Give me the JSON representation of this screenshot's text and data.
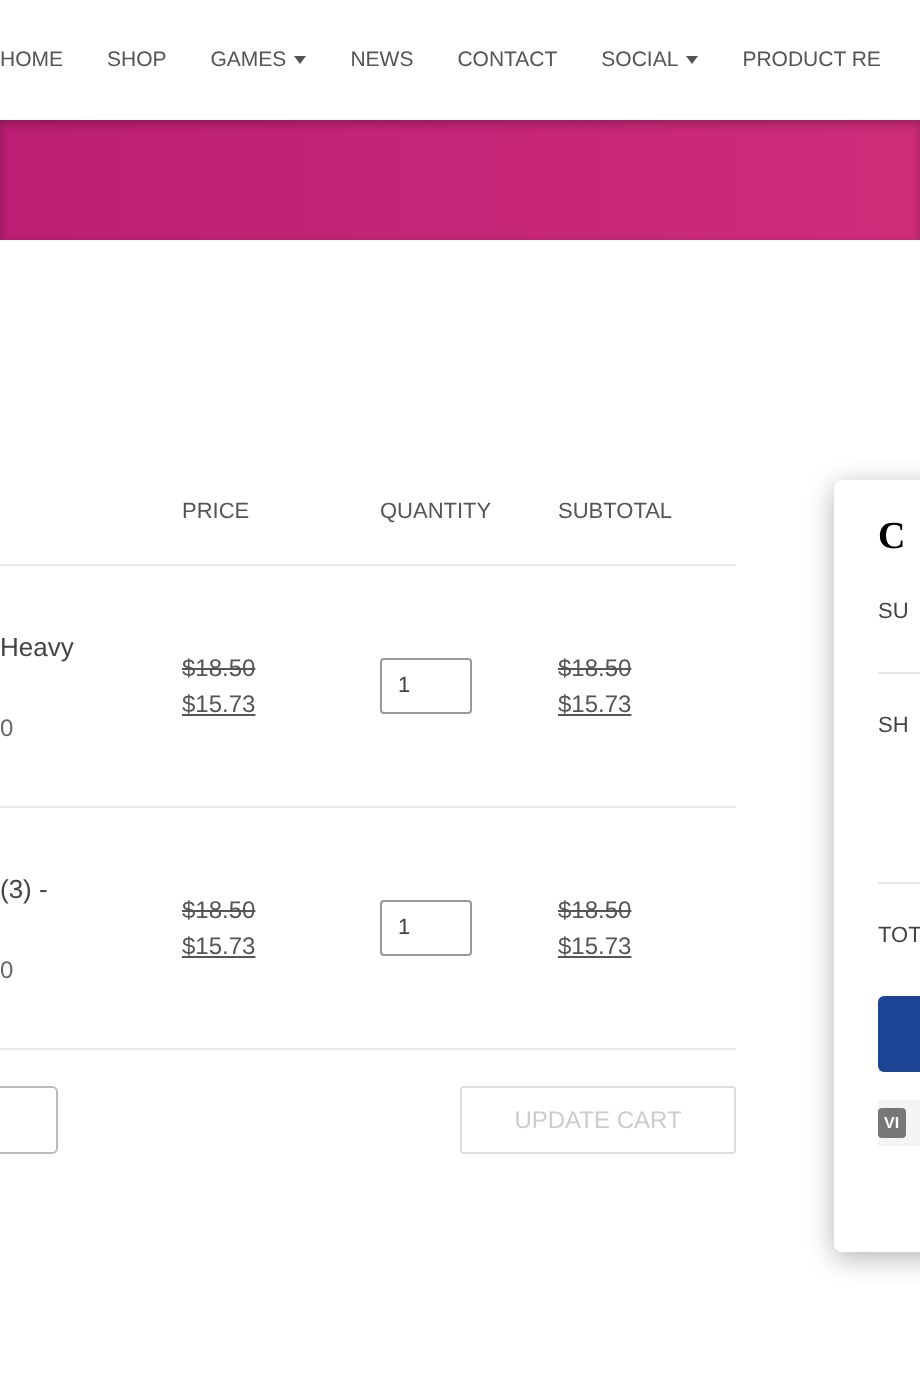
{
  "nav": [
    {
      "label": "HOME",
      "dropdown": false
    },
    {
      "label": "SHOP",
      "dropdown": false
    },
    {
      "label": "GAMES",
      "dropdown": true
    },
    {
      "label": "NEWS",
      "dropdown": false
    },
    {
      "label": "CONTACT",
      "dropdown": false
    },
    {
      "label": "SOCIAL",
      "dropdown": true
    },
    {
      "label": "PRODUCT RE",
      "dropdown": false
    }
  ],
  "cart": {
    "columns": [
      "PRICE",
      "QUANTITY",
      "SUBTOTAL"
    ],
    "rows": [
      {
        "name": "Heavy",
        "note": "0",
        "old_price": "$18.50",
        "price": "$15.73",
        "quantity": "1",
        "old_subtotal": "$18.50",
        "subtotal": "$15.73"
      },
      {
        "name": "(3) -",
        "note": "0",
        "old_price": "$18.50",
        "price": "$15.73",
        "quantity": "1",
        "old_subtotal": "$18.50",
        "subtotal": "$15.73"
      }
    ],
    "update_button": {
      "label": "UPDATE CART",
      "disabled": true
    }
  },
  "totals": {
    "title": "C",
    "rows": [
      "SU",
      "SH",
      "TOT"
    ],
    "card_label": "VI"
  }
}
